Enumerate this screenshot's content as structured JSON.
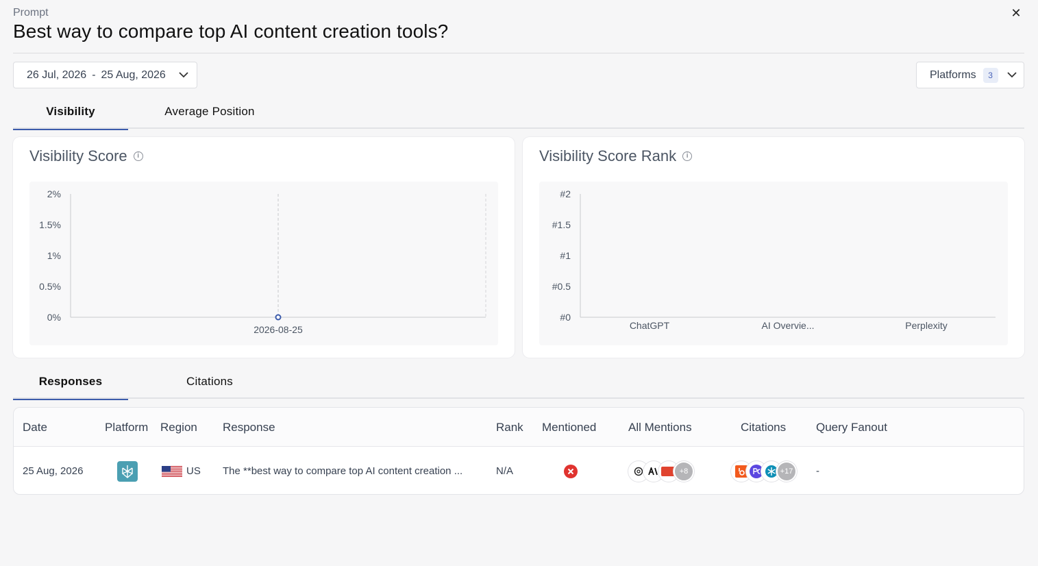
{
  "header": {
    "label": "Prompt",
    "title": "Best way to compare top AI content creation tools?",
    "close": "✕"
  },
  "filters": {
    "date_start": "26 Jul, 2026",
    "date_sep": "-",
    "date_end": "25 Aug, 2026",
    "platforms_label": "Platforms",
    "platforms_count": "3"
  },
  "top_tabs": [
    {
      "label": "Visibility",
      "active": true
    },
    {
      "label": "Average Position",
      "active": false
    }
  ],
  "cards": {
    "visibility_score": {
      "title": "Visibility Score",
      "info": "i"
    },
    "visibility_rank": {
      "title": "Visibility Score Rank",
      "info": "i"
    }
  },
  "chart_data": [
    {
      "type": "line",
      "title": "Visibility Score",
      "y_ticks": [
        "2%",
        "1.5%",
        "1%",
        "0.5%",
        "0%"
      ],
      "ylim": [
        0,
        2
      ],
      "x": [
        "2026-08-25"
      ],
      "series": [
        {
          "values": [
            0
          ]
        }
      ],
      "accent": "#3b5bab"
    },
    {
      "type": "bar",
      "title": "Visibility Score Rank",
      "y_ticks": [
        "#2",
        "#1.5",
        "#1",
        "#0.5",
        "#0"
      ],
      "ylim": [
        0,
        2
      ],
      "categories": [
        "ChatGPT",
        "AI Overvie...",
        "Perplexity"
      ],
      "values": [
        0,
        0,
        0
      ]
    }
  ],
  "bottom_tabs": [
    {
      "label": "Responses",
      "active": true
    },
    {
      "label": "Citations",
      "active": false
    }
  ],
  "table": {
    "headers": [
      "Date",
      "Platform",
      "Region",
      "Response",
      "Rank",
      "Mentioned",
      "All Mentions",
      "Citations",
      "Query Fanout"
    ],
    "rows": [
      {
        "date": "25 Aug, 2026",
        "platform_icon": "perplexity-icon",
        "region": "US",
        "response": "The **best way to compare top AI content creation ...",
        "rank": "N/A",
        "mentioned_icon": "x-circle-icon",
        "mentions_more": "+8",
        "citations_more": "+17",
        "query_fanout": "-"
      }
    ]
  },
  "colors": {
    "accent": "#3b5bab",
    "mentioned_no": "#e0332f",
    "platform_teal": "#4b9fb2"
  }
}
